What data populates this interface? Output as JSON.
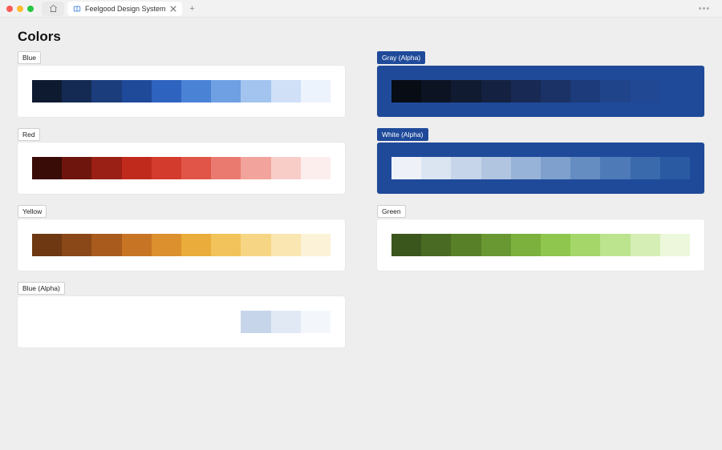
{
  "titlebar": {
    "tab_title": "Feelgood Design System",
    "new_tab_symbol": "+",
    "overflow_symbol": "•••"
  },
  "page": {
    "heading": "Colors"
  },
  "palettes": {
    "left": [
      {
        "label": "Blue",
        "label_style": "light",
        "card_style": "light",
        "swatches": [
          "#0e1a2f",
          "#142a53",
          "#1c3d7c",
          "#1f4a9a",
          "#2e63bf",
          "#4a82d6",
          "#6fa0e3",
          "#a2c4ef",
          "#cfe0f7",
          "#ecf3fc"
        ]
      },
      {
        "label": "Red",
        "label_style": "light",
        "card_style": "light",
        "swatches": [
          "#3a0c07",
          "#6e160d",
          "#9a1f14",
          "#c02a1d",
          "#d33b2c",
          "#e05547",
          "#ea7a6f",
          "#f2a39b",
          "#f8cdc8",
          "#fceeec"
        ]
      },
      {
        "label": "Yellow",
        "label_style": "light",
        "card_style": "light",
        "swatches": [
          "#6e3812",
          "#8a4717",
          "#a85b1c",
          "#c77524",
          "#dc902e",
          "#eaac3a",
          "#f2c35a",
          "#f6d684",
          "#f9e6b0",
          "#fcf2d8"
        ]
      },
      {
        "label": "Blue (Alpha)",
        "label_style": "light",
        "card_style": "light",
        "swatches": [
          "#ffffff",
          "#ffffff",
          "#ffffff",
          "#ffffff",
          "#ffffff",
          "#ffffff",
          "#ffffff",
          "#c6d5e9",
          "#e1e9f5",
          "#f3f7fc"
        ]
      }
    ],
    "right": [
      {
        "label": "Gray (Alpha)",
        "label_style": "dark",
        "card_style": "dark",
        "swatches": [
          "#080c14",
          "#0c1322",
          "#101a30",
          "#142140",
          "#182a54",
          "#1b3266",
          "#1d3b7a",
          "#1f4489",
          "#204893",
          "#1f4a9a"
        ]
      },
      {
        "label": "White (Alpha)",
        "label_style": "dark",
        "card_style": "dark",
        "swatches": [
          "#eef2f8",
          "#dbe4f1",
          "#c7d5ea",
          "#b1c5e1",
          "#98b3d8",
          "#7fa0cd",
          "#668dc2",
          "#4e7bb8",
          "#3a6aac",
          "#2a5aa2"
        ]
      },
      {
        "label": "Green",
        "label_style": "light",
        "card_style": "light",
        "swatches": [
          "#3b561c",
          "#496a22",
          "#588029",
          "#699832",
          "#7bb13c",
          "#8fc64d",
          "#a4d66a",
          "#bce38e",
          "#d5eeb5",
          "#ecf7db"
        ]
      }
    ]
  }
}
